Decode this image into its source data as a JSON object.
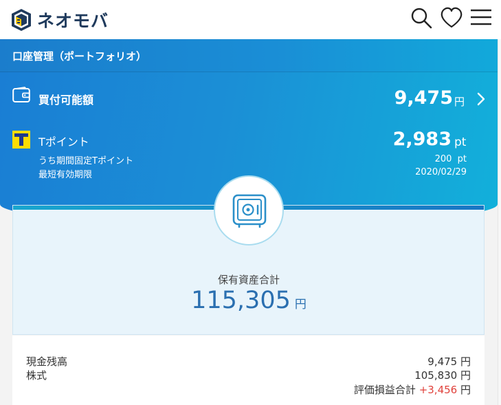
{
  "header": {
    "brand": "ネオモバ",
    "icons": [
      "logo-icon",
      "search-icon",
      "heart-icon",
      "menu-icon"
    ]
  },
  "portfolio": {
    "title": "口座管理（ポートフォリオ）"
  },
  "buying_power": {
    "label": "買付可能額",
    "amount": "9,475",
    "unit": "円"
  },
  "tpoint": {
    "label": "Tポイント",
    "amount": "2,983",
    "unit": "pt",
    "fixed_label": "うち期間固定Tポイント",
    "fixed_value": "200  pt",
    "expiry_label": "最短有効期限",
    "expiry_value": "2020/02/29"
  },
  "assets": {
    "label": "保有資産合計",
    "total": "115,305",
    "unit": "円"
  },
  "breakdown": {
    "cash_label": "現金残高",
    "cash_value": "9,475 円",
    "stock_label": "株式",
    "stock_value": "105,830 円",
    "pnl_label": "評価損益合計",
    "pnl_value": "+3,456",
    "pnl_unit": "円"
  },
  "colors": {
    "brand_blue": "#1a8ed6",
    "accent_cyan": "#12b0da",
    "total_blue": "#2a6fb0",
    "gain_red": "#e0413b",
    "tpoint_yellow": "#ffdd00"
  }
}
